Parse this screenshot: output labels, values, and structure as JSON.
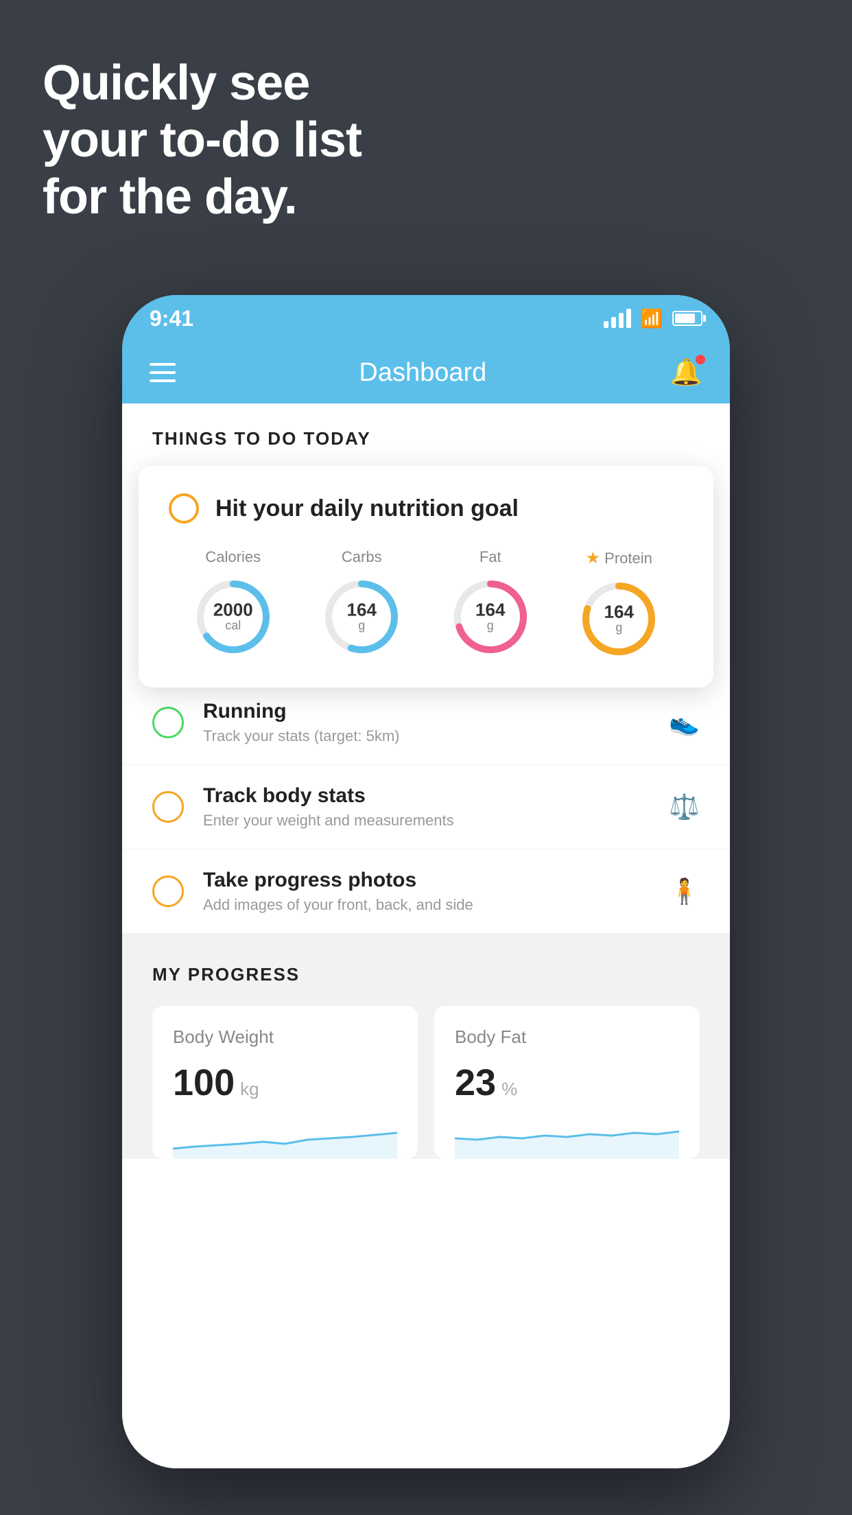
{
  "hero": {
    "line1": "Quickly see",
    "line2": "your to-do list",
    "line3": "for the day."
  },
  "status_bar": {
    "time": "9:41"
  },
  "nav": {
    "title": "Dashboard"
  },
  "things_section": {
    "label": "THINGS TO DO TODAY"
  },
  "nutrition_card": {
    "title": "Hit your daily nutrition goal",
    "stats": [
      {
        "label": "Calories",
        "value": "2000",
        "unit": "cal",
        "color": "#5bbfea",
        "percent": 65
      },
      {
        "label": "Carbs",
        "value": "164",
        "unit": "g",
        "color": "#5bbfea",
        "percent": 55
      },
      {
        "label": "Fat",
        "value": "164",
        "unit": "g",
        "color": "#f06090",
        "percent": 70
      },
      {
        "label": "Protein",
        "value": "164",
        "unit": "g",
        "color": "#f5a623",
        "percent": 80,
        "starred": true
      }
    ]
  },
  "todo_items": [
    {
      "title": "Running",
      "subtitle": "Track your stats (target: 5km)",
      "circle_color": "green",
      "icon": "shoe"
    },
    {
      "title": "Track body stats",
      "subtitle": "Enter your weight and measurements",
      "circle_color": "yellow",
      "icon": "scale"
    },
    {
      "title": "Take progress photos",
      "subtitle": "Add images of your front, back, and side",
      "circle_color": "yellow",
      "icon": "person"
    }
  ],
  "progress_section": {
    "label": "MY PROGRESS",
    "cards": [
      {
        "title": "Body Weight",
        "value": "100",
        "unit": "kg"
      },
      {
        "title": "Body Fat",
        "value": "23",
        "unit": "%"
      }
    ]
  }
}
